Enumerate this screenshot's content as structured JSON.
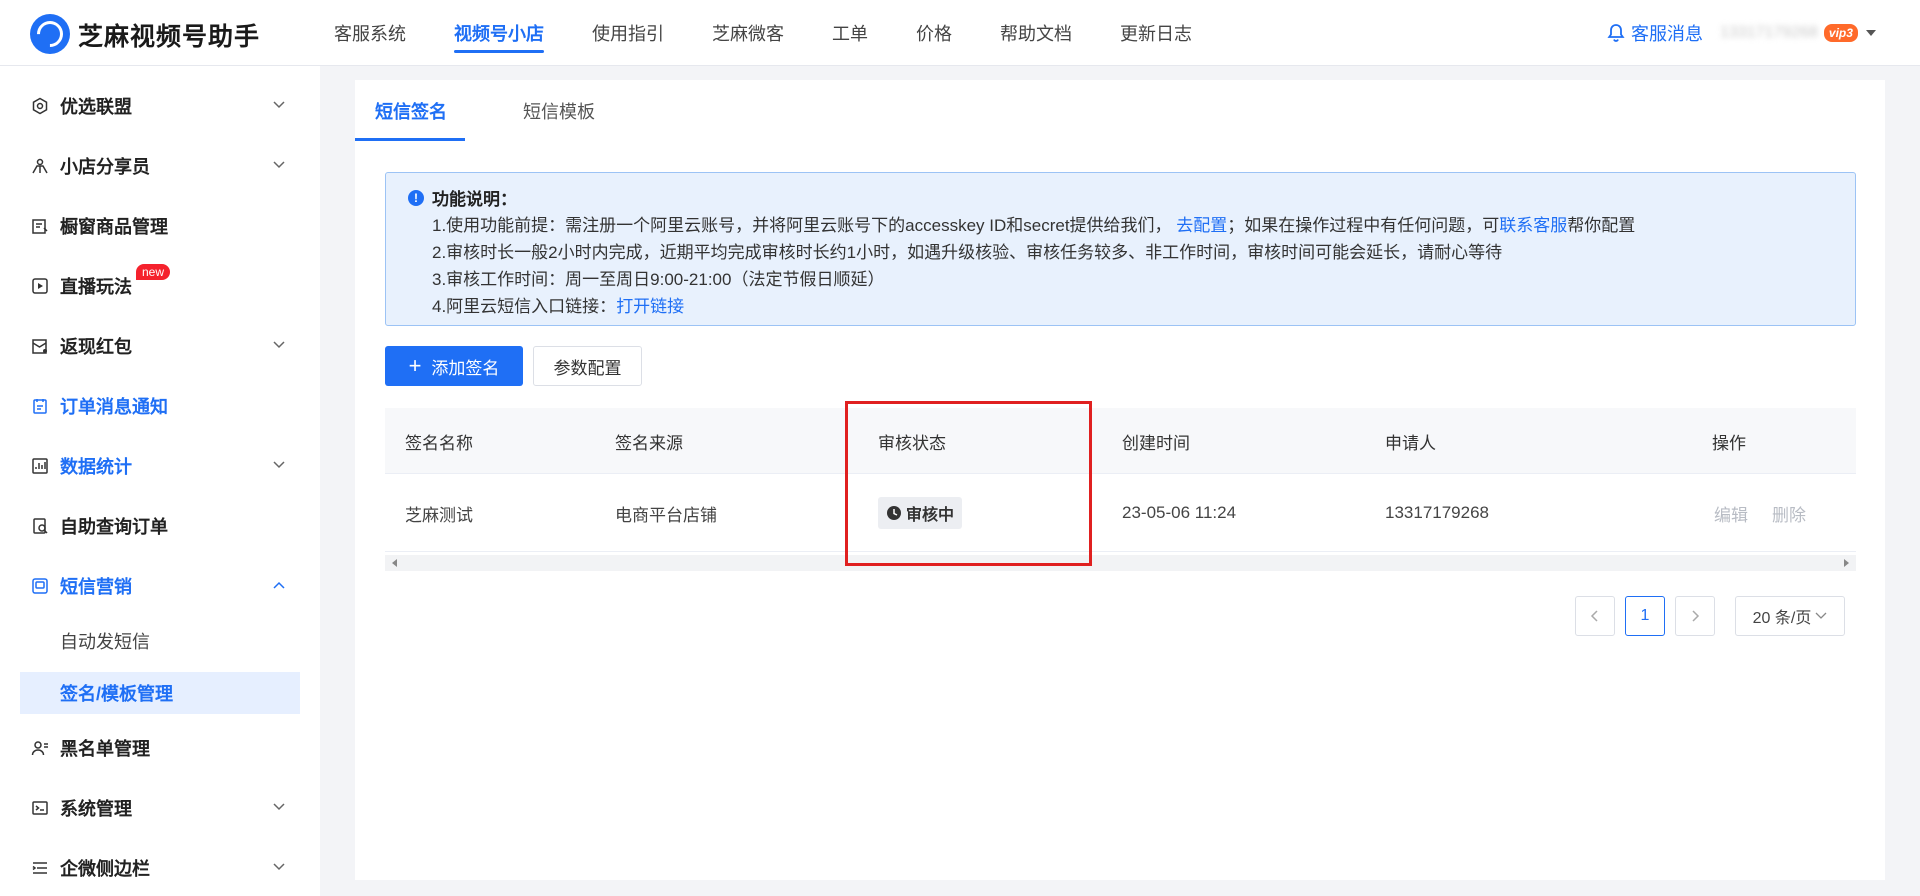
{
  "header": {
    "app_title": "芝麻视频号助手",
    "nav": [
      "客服系统",
      "视频号小店",
      "使用指引",
      "芝麻微客",
      "工单",
      "价格",
      "帮助文档",
      "更新日志"
    ],
    "active_nav": 1,
    "message_label": "客服消息",
    "user_name": "13317179268",
    "vip_label": "vip3"
  },
  "sidebar": {
    "items": [
      {
        "label": "优选联盟",
        "icon": "alliance-icon"
      },
      {
        "label": "小店分享员",
        "icon": "sharer-icon"
      },
      {
        "label": "橱窗商品管理",
        "icon": "showcase-icon"
      },
      {
        "label": "直播玩法",
        "icon": "live-icon",
        "badge": "new"
      },
      {
        "label": "返现红包",
        "icon": "red-envelope-icon"
      },
      {
        "label": "订单消息通知",
        "icon": "order-notice-icon"
      },
      {
        "label": "数据统计",
        "icon": "stats-icon"
      },
      {
        "label": "自助查询订单",
        "icon": "order-query-icon"
      },
      {
        "label": "短信营销",
        "icon": "sms-icon"
      },
      {
        "label": "黑名单管理",
        "icon": "blacklist-icon"
      },
      {
        "label": "系统管理",
        "icon": "terminal-icon"
      },
      {
        "label": "企微侧边栏",
        "icon": "sidebar-list-icon"
      }
    ],
    "sub_items": [
      "自动发短信",
      "签名/模板管理"
    ]
  },
  "tabs": [
    "短信签名",
    "短信模板"
  ],
  "info": {
    "title": "功能说明：",
    "line1_a": "1.使用功能前提：需注册一个阿里云账号，并将阿里云账号下的accesskey ID和secret提供给我们，",
    "line1_link1": "去配置",
    "line1_b": "；如果在操作过程中有任何问题，可",
    "line1_link2": "联系客服",
    "line1_c": "帮你配置",
    "line2": "2.审核时长一般2小时内完成，近期平均完成审核时长约1小时，如遇升级核验、审核任务较多、非工作时间，审核时间可能会延长，请耐心等待",
    "line3": "3.审核工作时间：周一至周日9:00-21:00（法定节假日顺延）",
    "line4_a": "4.阿里云短信入口链接：",
    "line4_link": "打开链接"
  },
  "actions": {
    "add_label": "添加签名",
    "config_label": "参数配置"
  },
  "table": {
    "headers": [
      "签名名称",
      "签名来源",
      "审核状态",
      "创建时间",
      "申请人",
      "操作"
    ],
    "rows": [
      {
        "name": "芝麻测试",
        "source": "电商平台店铺",
        "status": "审核中",
        "created": "23-05-06 11:24",
        "applicant": "13317179268",
        "edit": "编辑",
        "delete": "删除"
      }
    ]
  },
  "pagination": {
    "current_page": "1",
    "page_size": "20 条/页"
  },
  "colors": {
    "accent": "#1f6ff5",
    "highlight_box": "#e02020",
    "info_bg": "#e8f1fd"
  }
}
